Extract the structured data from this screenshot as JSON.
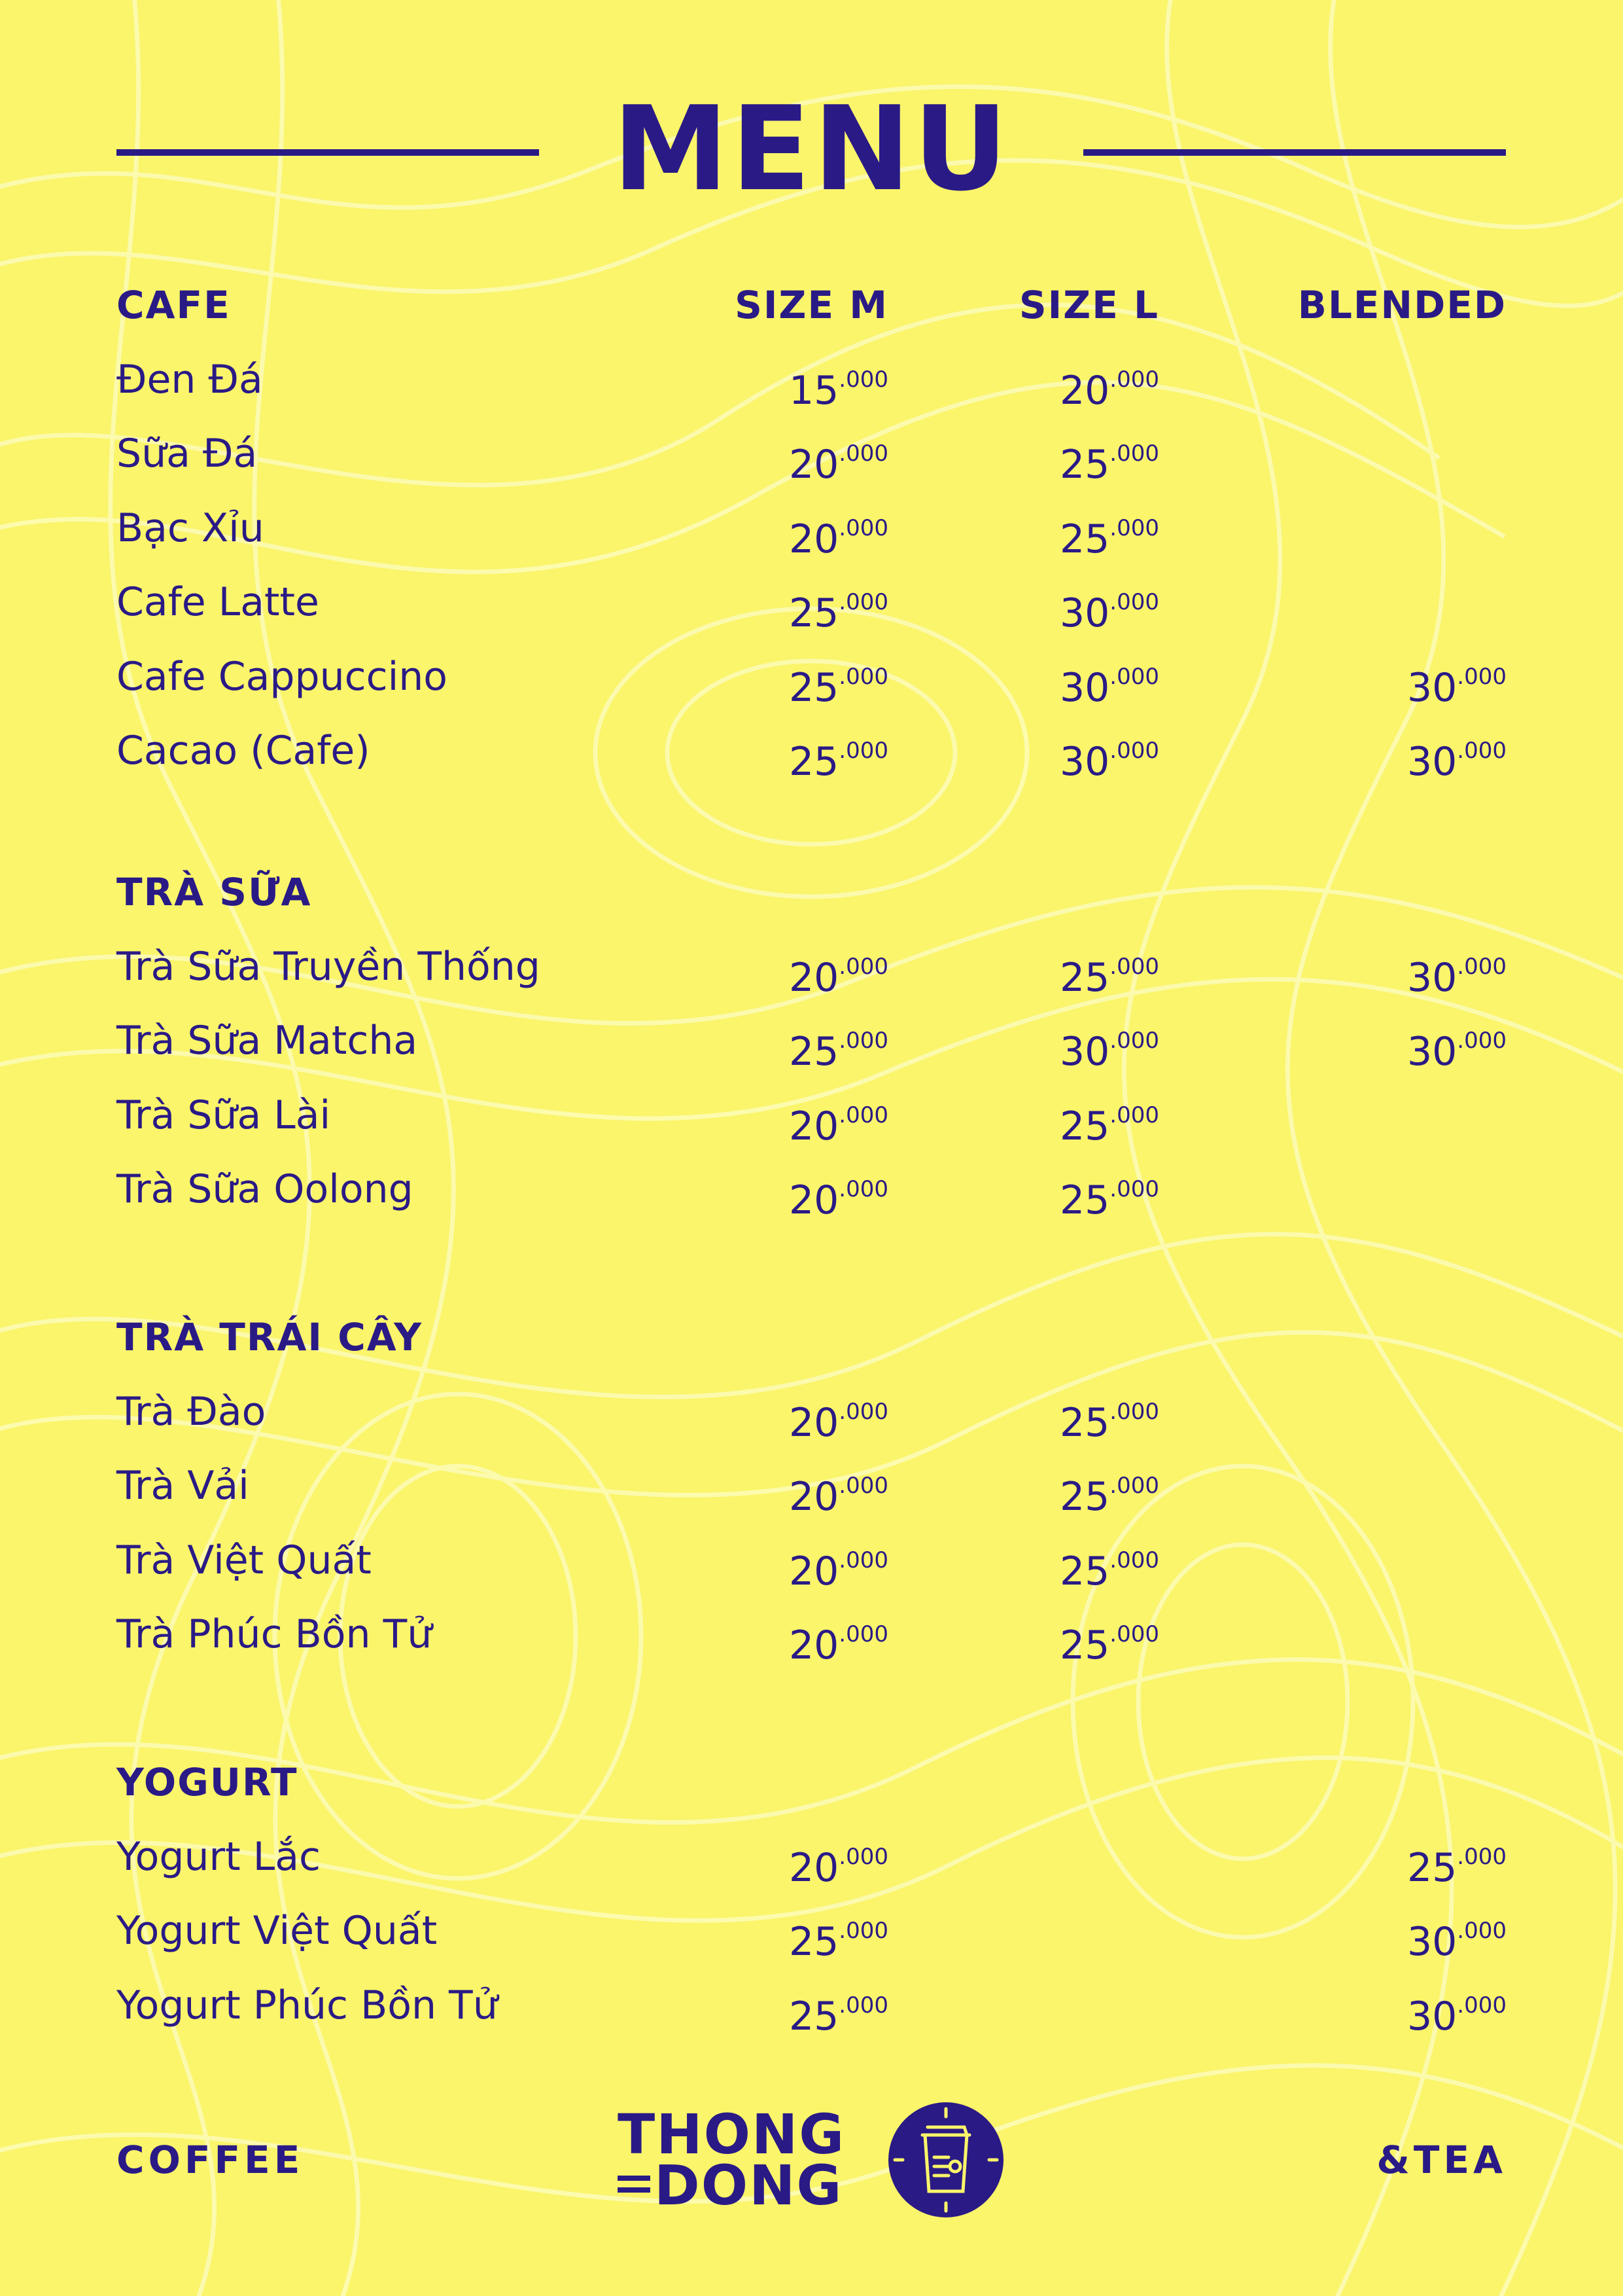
{
  "title": "MENU",
  "sections": [
    {
      "heading": "CAFE",
      "columns": [
        "SIZE M",
        "SIZE L",
        "BLENDED"
      ],
      "items": [
        {
          "name": "Đen Đá",
          "m": "15",
          "m_k": ".000",
          "l": "20",
          "l_k": ".000",
          "b": "",
          "b_k": ""
        },
        {
          "name": "Sữa Đá",
          "m": "20",
          "m_k": ".000",
          "l": "25",
          "l_k": ".000",
          "b": "",
          "b_k": ""
        },
        {
          "name": "Bạc Xỉu",
          "m": "20",
          "m_k": ".000",
          "l": "25",
          "l_k": ".000",
          "b": "",
          "b_k": ""
        },
        {
          "name": "Cafe Latte",
          "m": "25",
          "m_k": ".000",
          "l": "30",
          "l_k": ".000",
          "b": "",
          "b_k": ""
        },
        {
          "name": "Cafe Cappuccino",
          "m": "25",
          "m_k": ".000",
          "l": "30",
          "l_k": ".000",
          "b": "30",
          "b_k": ".000"
        },
        {
          "name": "Cacao (Cafe)",
          "m": "25",
          "m_k": ".000",
          "l": "30",
          "l_k": ".000",
          "b": "30",
          "b_k": ".000"
        }
      ]
    },
    {
      "heading": "TRÀ SỮA",
      "items": [
        {
          "name": "Trà Sữa Truyền Thống",
          "m": "20",
          "m_k": ".000",
          "l": "25",
          "l_k": ".000",
          "b": "30",
          "b_k": ".000"
        },
        {
          "name": "Trà Sữa Matcha",
          "m": "25",
          "m_k": ".000",
          "l": "30",
          "l_k": ".000",
          "b": "30",
          "b_k": ".000"
        },
        {
          "name": "Trà Sữa Lài",
          "m": "20",
          "m_k": ".000",
          "l": "25",
          "l_k": ".000",
          "b": "",
          "b_k": ""
        },
        {
          "name": "Trà Sữa Oolong",
          "m": "20",
          "m_k": ".000",
          "l": "25",
          "l_k": ".000",
          "b": "",
          "b_k": ""
        }
      ]
    },
    {
      "heading": "TRÀ TRÁI CÂY",
      "items": [
        {
          "name": "Trà Đào",
          "m": "20",
          "m_k": ".000",
          "l": "25",
          "l_k": ".000",
          "b": "",
          "b_k": ""
        },
        {
          "name": "Trà Vải",
          "m": "20",
          "m_k": ".000",
          "l": "25",
          "l_k": ".000",
          "b": "",
          "b_k": ""
        },
        {
          "name": "Trà Việt Quất",
          "m": "20",
          "m_k": ".000",
          "l": "25",
          "l_k": ".000",
          "b": "",
          "b_k": ""
        },
        {
          "name": "Trà Phúc Bồn Tử",
          "m": "20",
          "m_k": ".000",
          "l": "25",
          "l_k": ".000",
          "b": "",
          "b_k": ""
        }
      ]
    },
    {
      "heading": "YOGURT",
      "items": [
        {
          "name": "Yogurt Lắc",
          "m": "20",
          "m_k": ".000",
          "l": "",
          "l_k": "",
          "b": "25",
          "b_k": ".000"
        },
        {
          "name": "Yogurt Việt Quất",
          "m": "25",
          "m_k": ".000",
          "l": "",
          "l_k": "",
          "b": "30",
          "b_k": ".000"
        },
        {
          "name": "Yogurt Phúc Bồn Tử",
          "m": "25",
          "m_k": ".000",
          "l": "",
          "l_k": "",
          "b": "30",
          "b_k": ".000"
        }
      ]
    }
  ],
  "footer": {
    "left": "COFFEE",
    "right": "&TEA",
    "brand_line1": "THONG",
    "brand_line2": "DONG",
    "logo_icon": "coffee-cup-badge-icon"
  },
  "colors": {
    "background": "#faf56a",
    "ink": "#2a1a86",
    "pattern": "#fdfbb8"
  }
}
